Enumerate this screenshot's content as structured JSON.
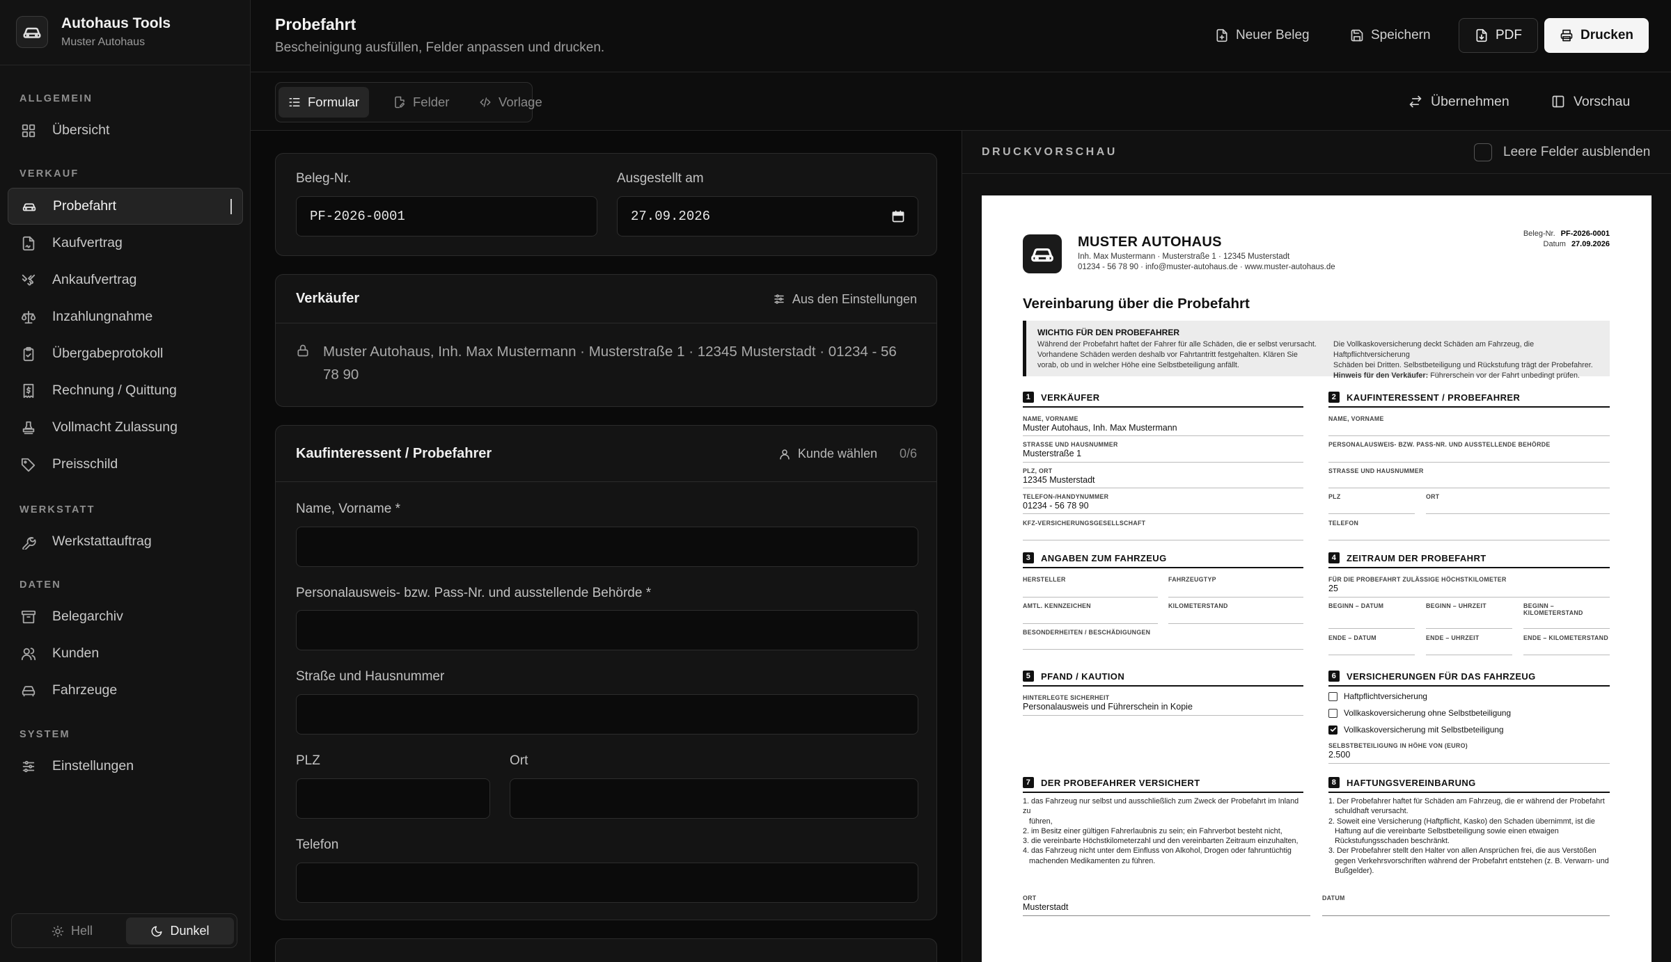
{
  "brand": {
    "name": "Autohaus Tools",
    "sub": "Muster Autohaus"
  },
  "sidebar": {
    "sections": {
      "allgemein": "ALLGEMEIN",
      "verkauf": "VERKAUF",
      "werkstatt": "WERKSTATT",
      "daten": "DATEN",
      "system": "SYSTEM"
    },
    "items": {
      "uebersicht": "Übersicht",
      "probefahrt": "Probefahrt",
      "kaufvertrag": "Kaufvertrag",
      "ankaufvertrag": "Ankaufvertrag",
      "inzahlungnahme": "Inzahlungnahme",
      "uebergabe": "Übergabeprotokoll",
      "rechnung": "Rechnung / Quittung",
      "vollmacht": "Vollmacht Zulassung",
      "preisschild": "Preisschild",
      "werkstattauftrag": "Werkstattauftrag",
      "belegarchiv": "Belegarchiv",
      "kunden": "Kunden",
      "fahrzeuge": "Fahrzeuge",
      "einstellungen": "Einstellungen"
    },
    "active": "probefahrt",
    "theme": {
      "light": "Hell",
      "dark": "Dunkel",
      "selected": "dark"
    }
  },
  "header": {
    "title": "Probefahrt",
    "subtitle": "Bescheinigung ausfüllen, Felder anpassen und drucken.",
    "buttons": {
      "neu": "Neuer Beleg",
      "save": "Speichern",
      "pdf": "PDF",
      "print": "Drucken"
    }
  },
  "toolbar": {
    "tabs": {
      "formular": "Formular",
      "felder": "Felder",
      "vorlage": "Vorlage"
    },
    "active_tab": "formular",
    "uebernehmen": "Übernehmen",
    "vorschau": "Vorschau"
  },
  "form": {
    "beleg_label": "Beleg-Nr.",
    "beleg_value": "PF-2026-0001",
    "datum_label": "Ausgestellt am",
    "datum_value": "27.09.2026",
    "verkaeufer": {
      "title": "Verkäufer",
      "action": "Aus den Einstellungen",
      "text": "Muster Autohaus, Inh. Max Mustermann · Musterstraße 1 · 12345 Musterstadt · 01234 - 56 78 90"
    },
    "kunde": {
      "title": "Kaufinteressent / Probefahrer",
      "action": "Kunde wählen",
      "count": "0/6",
      "name_label": "Name, Vorname *",
      "ausweis_label": "Personalausweis- bzw. Pass-Nr. und ausstellende Behörde *",
      "strasse_label": "Straße und Hausnummer",
      "plz_label": "PLZ",
      "ort_label": "Ort",
      "telefon_label": "Telefon"
    }
  },
  "preview": {
    "title": "DRUCKVORSCHAU",
    "hide_empty": "Leere Felder ausblenden",
    "hide_empty_checked": false
  },
  "document": {
    "company": "MUSTER AUTOHAUS",
    "company_line1": "Inh. Max Mustermann · Musterstraße 1 · 12345 Musterstadt",
    "company_line2": "01234 - 56 78 90 · info@muster-autohaus.de · www.muster-autohaus.de",
    "beleg_label": "Beleg-Nr.",
    "beleg": "PF-2026-0001",
    "datum_label": "Datum",
    "datum": "27.09.2026",
    "title": "Vereinbarung über die Probefahrt",
    "notice_title": "WICHTIG FÜR DEN PROBEFAHRER",
    "notice_left": [
      "Während der Probefahrt haftet der Fahrer für alle Schäden, die er selbst verursacht.",
      "Vorhandene Schäden werden deshalb vor Fahrtantritt festgehalten. Klären Sie",
      "vorab, ob und in welcher Höhe eine Selbstbeteiligung anfällt."
    ],
    "notice_right": [
      "Die Vollkaskoversicherung deckt Schäden am Fahrzeug, die Haftpflichtversicherung",
      "Schäden bei Dritten. Selbstbeteiligung und Rückstufung trägt der Probefahrer."
    ],
    "notice_hint_bold": "Hinweis für den Verkäufer:",
    "notice_hint": " Führerschein vor der Fahrt unbedingt prüfen.",
    "s1": {
      "num": "1",
      "title": "VERKÄUFER",
      "name_l": "NAME, VORNAME",
      "name_v": "Muster Autohaus, Inh. Max Mustermann",
      "str_l": "STRASSE UND HAUSNUMMER",
      "str_v": "Musterstraße 1",
      "plz_l": "PLZ, ORT",
      "plz_v": "12345 Musterstadt",
      "tel_l": "TELEFON-/HANDYNUMMER",
      "tel_v": "01234 - 56 78 90",
      "kfz_l": "KFZ-VERSICHERUNGSGESELLSCHAFT"
    },
    "s2": {
      "num": "2",
      "title": "KAUFINTERESSENT / PROBEFAHRER",
      "name_l": "NAME, VORNAME",
      "ausweis_l": "PERSONALAUSWEIS- BZW. PASS-NR. UND AUSSTELLENDE BEHÖRDE",
      "str_l": "STRASSE UND HAUSNUMMER",
      "plz_l": "PLZ",
      "ort_l": "ORT",
      "tel_l": "TELEFON"
    },
    "s3": {
      "num": "3",
      "title": "ANGABEN ZUM FAHRZEUG",
      "hersteller": "HERSTELLER",
      "typ": "FAHRZEUGTYP",
      "kennz": "AMTL. KENNZEICHEN",
      "km": "KILOMETERSTAND",
      "besonder": "BESONDERHEITEN / BESCHÄDIGUNGEN"
    },
    "s4": {
      "num": "4",
      "title": "ZEITRAUM DER PROBEFAHRT",
      "hoechst_l": "FÜR DIE PROBEFAHRT ZULÄSSIGE HÖCHSTKILOMETER",
      "hoechst_v": "25",
      "b_datum": "BEGINN – DATUM",
      "b_uhr": "BEGINN – UHRZEIT",
      "b_km1": "BEGINN –",
      "b_km2": "KILOMETERSTAND",
      "e_datum": "ENDE – DATUM",
      "e_uhr": "ENDE – UHRZEIT",
      "e_km": "ENDE – KILOMETERSTAND"
    },
    "s5": {
      "num": "5",
      "title": "PFAND / KAUTION",
      "sich_l": "HINTERLEGTE SICHERHEIT",
      "sich_v": "Personalausweis und Führerschein in Kopie"
    },
    "s6": {
      "num": "6",
      "title": "VERSICHERUNGEN FÜR DAS FAHRZEUG",
      "opts": [
        {
          "label": "Haftpflichtversicherung",
          "checked": false
        },
        {
          "label": "Vollkaskoversicherung ohne Selbstbeteiligung",
          "checked": false
        },
        {
          "label": "Vollkaskoversicherung mit Selbstbeteiligung",
          "checked": true
        }
      ],
      "sb_l": "SELBSTBETEILIGUNG IN HÖHE VON (EURO)",
      "sb_v": "2.500"
    },
    "s7": {
      "num": "7",
      "title": "DER PROBEFAHRER VERSICHERT",
      "items": [
        "1. das Fahrzeug nur selbst und ausschließlich zum Zweck der Probefahrt im Inland zu",
        "führen,",
        "2. im Besitz einer gültigen Fahrerlaubnis zu sein; ein Fahrverbot besteht nicht,",
        "3. die vereinbarte Höchstkilometerzahl und den vereinbarten Zeitraum einzuhalten,",
        "4. das Fahrzeug nicht unter dem Einfluss von Alkohol, Drogen oder fahruntüchtig",
        "machenden Medikamenten zu führen."
      ]
    },
    "s8": {
      "num": "8",
      "title": "HAFTUNGSVEREINBARUNG",
      "items": [
        "1. Der Probefahrer haftet für Schäden am Fahrzeug, die er während der Probefahrt",
        "schuldhaft verursacht.",
        "2. Soweit eine Versicherung (Haftpflicht, Kasko) den Schaden übernimmt, ist die",
        "Haftung auf die vereinbarte Selbstbeteiligung sowie einen etwaigen",
        "Rückstufungsschaden beschränkt.",
        "3. Der Probefahrer stellt den Halter von allen Ansprüchen frei, die aus Verstößen",
        "gegen Verkehrsvorschriften während der Probefahrt entstehen (z. B. Verwarn- und",
        "Bußgelder)."
      ]
    },
    "ort_l": "ORT",
    "ort_v": "Musterstadt",
    "datum_l": "DATUM"
  }
}
